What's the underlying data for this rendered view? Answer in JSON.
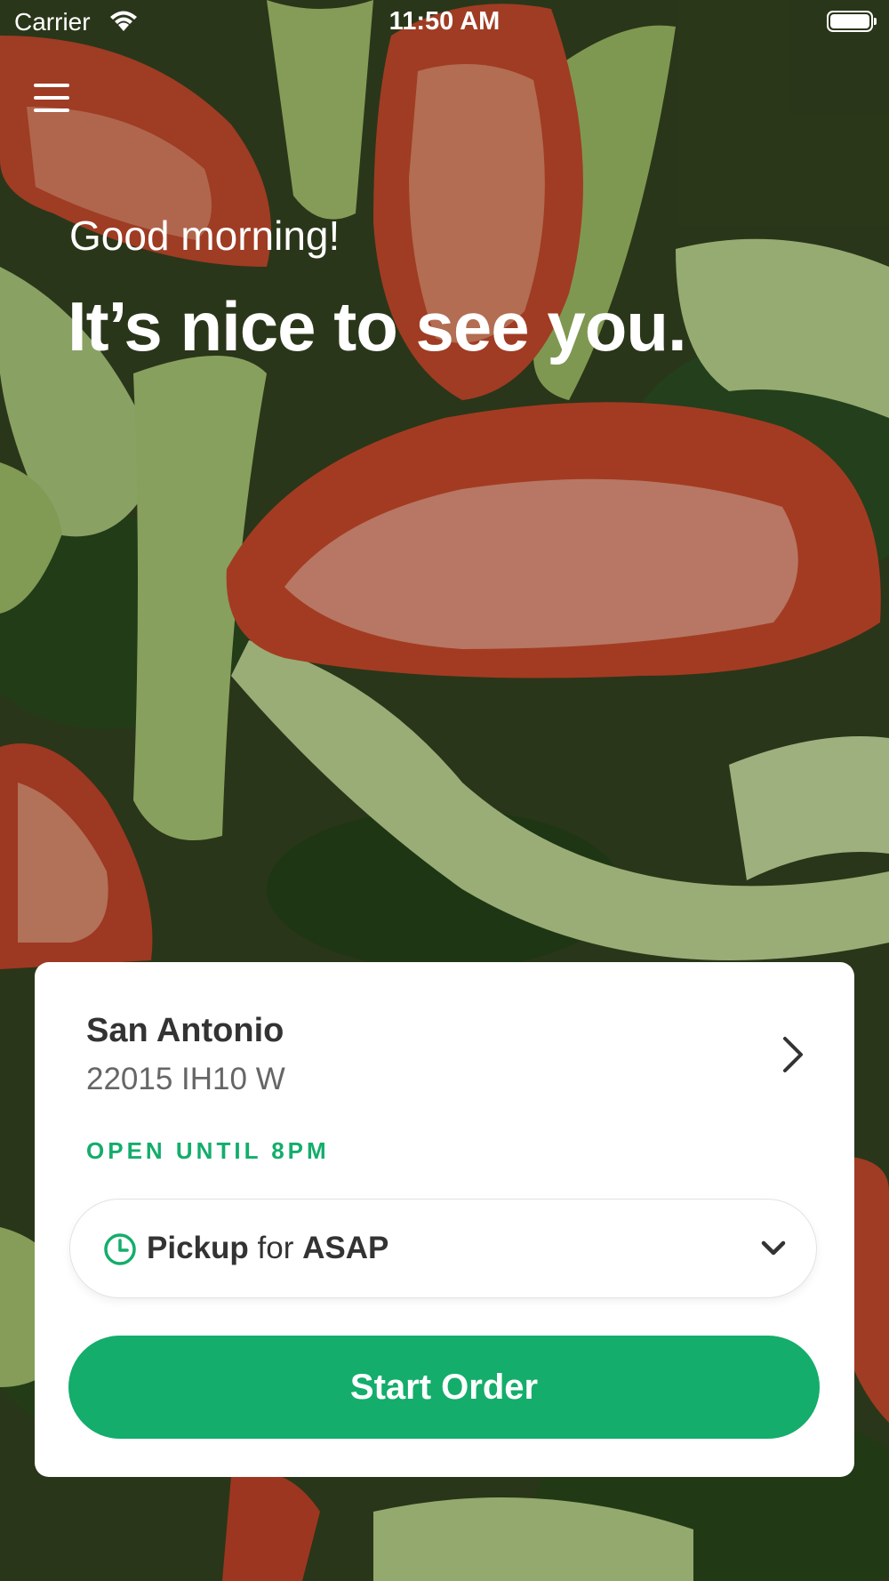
{
  "status_bar": {
    "carrier": "Carrier",
    "time": "11:50 AM"
  },
  "hero": {
    "greeting": "Good morning!",
    "headline": "It’s nice to see you."
  },
  "location_card": {
    "store_name": "San Antonio",
    "address": "22015 IH10 W",
    "hours_status": "OPEN UNTIL 8PM",
    "order_mode": {
      "method": "Pickup",
      "connector": "for",
      "timing": "ASAP"
    },
    "start_button_label": "Start Order"
  },
  "icons": {
    "menu": "hamburger-icon",
    "store_details": "chevron-right-icon",
    "pickup_time": "clock-icon",
    "order_mode_dropdown": "chevron-down-icon"
  },
  "colors": {
    "accent": "#14ad6b",
    "card_background": "#ffffff",
    "primary_text": "#333333",
    "secondary_text": "#666666"
  }
}
